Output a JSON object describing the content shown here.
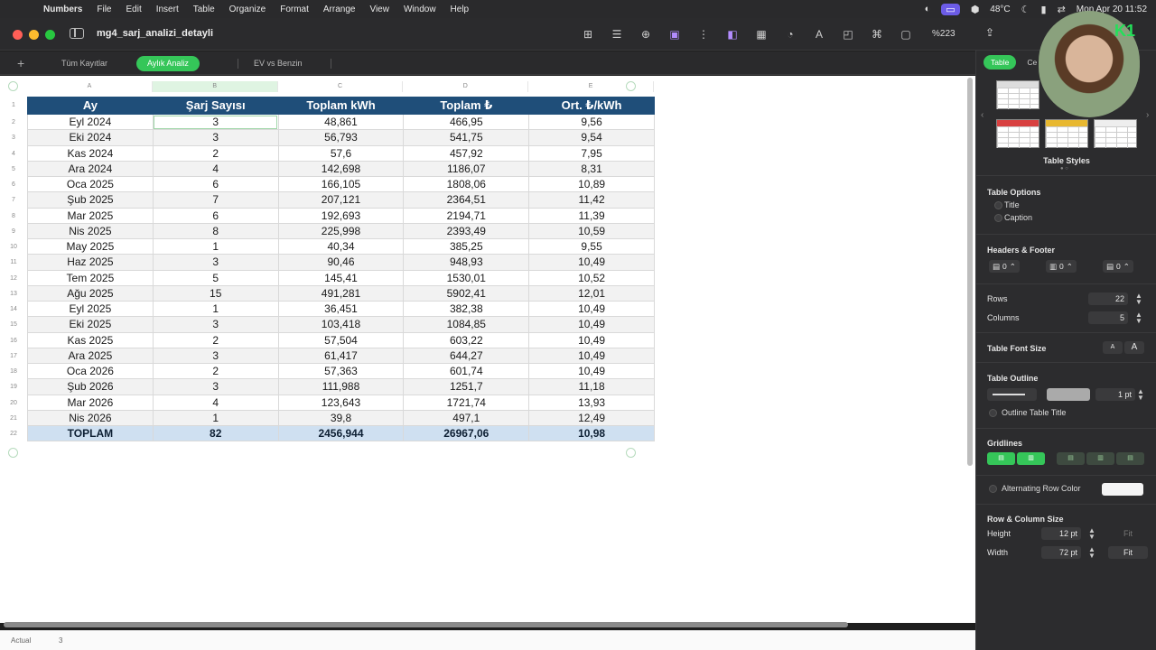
{
  "menubar": {
    "app_name": "Numbers",
    "items": [
      "File",
      "Edit",
      "Insert",
      "Table",
      "Organize",
      "Format",
      "Arrange",
      "View",
      "Window",
      "Help"
    ],
    "temperature": "48°C",
    "clock": "Mon Apr 20  11:52"
  },
  "window": {
    "doc_title": "mg4_sarj_analizi_detayli",
    "zoom": "%223"
  },
  "sheets": {
    "tabs": [
      "Tüm Kayıtlar",
      "Aylık Analiz",
      "EV vs Benzin"
    ],
    "active_index": 1
  },
  "grid": {
    "column_letters": [
      "A",
      "B",
      "C",
      "D",
      "E"
    ],
    "row_numbers": [
      "1",
      "2",
      "3",
      "4",
      "5",
      "6",
      "7",
      "8",
      "9",
      "10",
      "11",
      "12",
      "13",
      "14",
      "15",
      "16",
      "17",
      "18",
      "19",
      "20",
      "21",
      "22"
    ]
  },
  "table": {
    "headers": [
      "Ay",
      "Şarj Sayısı",
      "Toplam kWh",
      "Toplam ₺",
      "Ort. ₺/kWh"
    ],
    "rows": [
      [
        "Eyl 2024",
        "3",
        "48,861",
        "466,95",
        "9,56"
      ],
      [
        "Eki 2024",
        "3",
        "56,793",
        "541,75",
        "9,54"
      ],
      [
        "Kas 2024",
        "2",
        "57,6",
        "457,92",
        "7,95"
      ],
      [
        "Ara 2024",
        "4",
        "142,698",
        "1186,07",
        "8,31"
      ],
      [
        "Oca 2025",
        "6",
        "166,105",
        "1808,06",
        "10,89"
      ],
      [
        "Şub 2025",
        "7",
        "207,121",
        "2364,51",
        "11,42"
      ],
      [
        "Mar 2025",
        "6",
        "192,693",
        "2194,71",
        "11,39"
      ],
      [
        "Nis 2025",
        "8",
        "225,998",
        "2393,49",
        "10,59"
      ],
      [
        "May 2025",
        "1",
        "40,34",
        "385,25",
        "9,55"
      ],
      [
        "Haz 2025",
        "3",
        "90,46",
        "948,93",
        "10,49"
      ],
      [
        "Tem 2025",
        "5",
        "145,41",
        "1530,01",
        "10,52"
      ],
      [
        "Ağu 2025",
        "15",
        "491,281",
        "5902,41",
        "12,01"
      ],
      [
        "Eyl 2025",
        "1",
        "36,451",
        "382,38",
        "10,49"
      ],
      [
        "Eki 2025",
        "3",
        "103,418",
        "1084,85",
        "10,49"
      ],
      [
        "Kas 2025",
        "2",
        "57,504",
        "603,22",
        "10,49"
      ],
      [
        "Ara 2025",
        "3",
        "61,417",
        "644,27",
        "10,49"
      ],
      [
        "Oca 2026",
        "2",
        "57,363",
        "601,74",
        "10,49"
      ],
      [
        "Şub 2026",
        "3",
        "111,988",
        "1251,7",
        "11,18"
      ],
      [
        "Mar 2026",
        "4",
        "123,643",
        "1721,74",
        "13,93"
      ],
      [
        "Nis 2026",
        "1",
        "39,8",
        "497,1",
        "12,49"
      ]
    ],
    "total": [
      "TOPLAM",
      "82",
      "2456,944",
      "26967,06",
      "10,98"
    ]
  },
  "statusbar": {
    "label": "Actual",
    "value": "3"
  },
  "inspector": {
    "tabs": [
      "Table",
      "Ce"
    ],
    "styles_label": "Table Styles",
    "table_options": {
      "title": "Table Options",
      "opt_title": "Title",
      "opt_caption": "Caption"
    },
    "headers_footer": {
      "title": "Headers & Footer",
      "header_rows": "0",
      "header_cols": "0",
      "footer_rows": "0"
    },
    "rows_label": "Rows",
    "rows_value": "22",
    "columns_label": "Columns",
    "columns_value": "5",
    "font_size_label": "Table Font Size",
    "font_small": "A",
    "font_large": "A",
    "outline_label": "Table Outline",
    "outline_width": "1 pt",
    "outline_title_label": "Outline Table Title",
    "gridlines_label": "Gridlines",
    "alt_row_label": "Alternating Row Color",
    "row_col_size_label": "Row & Column Size",
    "height_label": "Height",
    "height_value": "12 pt",
    "width_label": "Width",
    "width_value": "72 pt",
    "fit_label": "Fit"
  },
  "colors": {
    "accent_green": "#35c659",
    "header_fill": "#1f4e79",
    "total_fill": "#cfe0f1"
  }
}
